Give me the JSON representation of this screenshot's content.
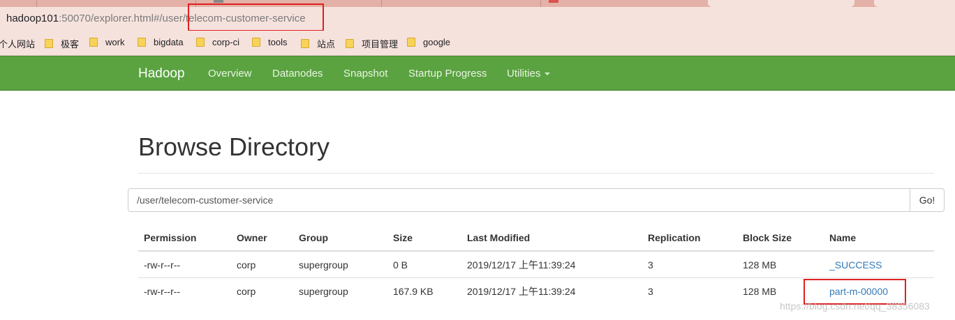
{
  "browser": {
    "url_host": "hadoop101",
    "url_rest": ":50070/explorer.html#/user/telecom-customer-service",
    "bookmarks": [
      "个人网站",
      "极客",
      "work",
      "bigdata",
      "corp-ci",
      "tools",
      "站点",
      "项目管理",
      "google"
    ]
  },
  "navbar": {
    "brand": "Hadoop",
    "items": [
      "Overview",
      "Datanodes",
      "Snapshot",
      "Startup Progress",
      "Utilities"
    ]
  },
  "page": {
    "title": "Browse Directory",
    "path_value": "/user/telecom-customer-service",
    "go_label": "Go!"
  },
  "table": {
    "headers": [
      "Permission",
      "Owner",
      "Group",
      "Size",
      "Last Modified",
      "Replication",
      "Block Size",
      "Name"
    ],
    "rows": [
      [
        "-rw-r--r--",
        "corp",
        "supergroup",
        "0 B",
        "2019/12/17 上午11:39:24",
        "3",
        "128 MB",
        "_SUCCESS"
      ],
      [
        "-rw-r--r--",
        "corp",
        "supergroup",
        "167.9 KB",
        "2019/12/17 上午11:39:24",
        "3",
        "128 MB",
        "part-m-00000"
      ]
    ]
  },
  "watermark": "https://blog.csdn.net/qq_38356083",
  "colors": {
    "navbar": "#5aa340",
    "link": "#337ab7",
    "highlight": "#e02020"
  }
}
